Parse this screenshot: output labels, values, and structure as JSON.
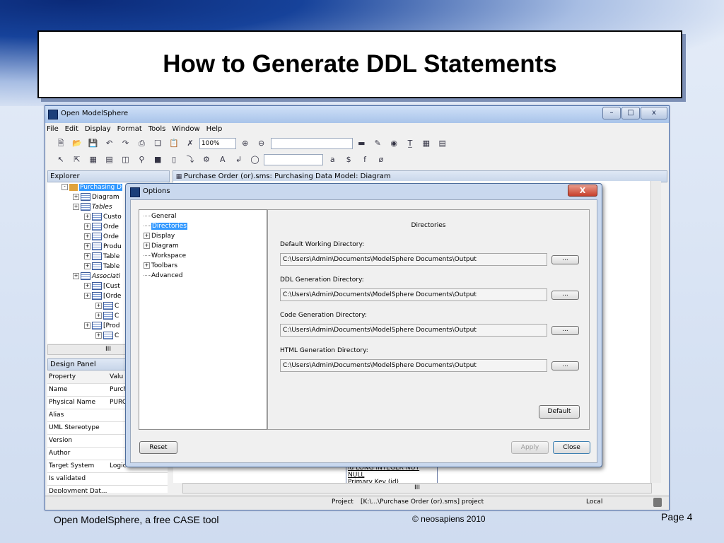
{
  "slide": {
    "title": "How to Generate DDL Statements",
    "footer_left": "Open ModelSphere, a free CASE tool",
    "footer_center": "© neosapiens 2010",
    "footer_right": "Page 4"
  },
  "app": {
    "window_title": "Open ModelSphere",
    "menu": [
      "File",
      "Edit",
      "Display",
      "Format",
      "Tools",
      "Window",
      "Help"
    ],
    "zoom": "100%",
    "format_glyphs": [
      "a",
      "$",
      "f",
      "ø"
    ]
  },
  "explorer": {
    "header": "Explorer",
    "root": "Purchasing D",
    "items": [
      {
        "label": "Diagram",
        "indent": 1
      },
      {
        "label": "Tables",
        "indent": 1
      },
      {
        "label": "Custo",
        "indent": 2
      },
      {
        "label": "Orde",
        "indent": 2
      },
      {
        "label": "Orde",
        "indent": 2
      },
      {
        "label": "Produ",
        "indent": 2
      },
      {
        "label": "Table",
        "indent": 2
      },
      {
        "label": "Table",
        "indent": 2
      },
      {
        "label": "Associati",
        "indent": 1
      },
      {
        "label": "[Cust",
        "indent": 2
      },
      {
        "label": "[Orde",
        "indent": 2
      },
      {
        "label": "C",
        "indent": 3
      },
      {
        "label": "C",
        "indent": 3
      },
      {
        "label": "[Prod",
        "indent": 2
      },
      {
        "label": "C",
        "indent": 3
      }
    ],
    "hscroll_glyph": "III"
  },
  "design_panel": {
    "header": "Design Panel",
    "col_property": "Property",
    "col_value": "Valu",
    "rows": [
      {
        "property": "Name",
        "value": "Purch"
      },
      {
        "property": "Physical Name",
        "value": "PURC"
      },
      {
        "property": "Alias",
        "value": ""
      },
      {
        "property": "UML Stereotype",
        "value": ""
      },
      {
        "property": "Version",
        "value": ""
      },
      {
        "property": "Author",
        "value": ""
      },
      {
        "property": "Target System",
        "value": "Logic"
      },
      {
        "property": "Is validated",
        "value": ""
      },
      {
        "property": "Deployment Dat...",
        "value": ""
      }
    ]
  },
  "diagram_tab": {
    "title": "Purchase Order (or).sms: Purchasing Data Model: Diagram",
    "column_text": "id LONG INTEGER NOT NULL",
    "pk_text": "Primary Key (id)",
    "hscroll_glyph": "III"
  },
  "dialog": {
    "title": "Options",
    "close_glyph": "X",
    "nav": [
      {
        "label": "General",
        "expandable": false,
        "selected": false
      },
      {
        "label": "Directories",
        "expandable": false,
        "selected": true
      },
      {
        "label": "Display",
        "expandable": true,
        "selected": false
      },
      {
        "label": "Diagram",
        "expandable": true,
        "selected": false
      },
      {
        "label": "Workspace",
        "expandable": false,
        "selected": false
      },
      {
        "label": "Toolbars",
        "expandable": true,
        "selected": false
      },
      {
        "label": "Advanced",
        "expandable": false,
        "selected": false
      }
    ],
    "section_title": "Directories",
    "fields": [
      {
        "label": "Default Working Directory:",
        "value": "C:\\Users\\Admin\\Documents\\ModelSphere Documents\\Output",
        "browse": "..."
      },
      {
        "label": "DDL Generation Directory:",
        "value": "C:\\Users\\Admin\\Documents\\ModelSphere Documents\\Output",
        "browse": "..."
      },
      {
        "label": "Code Generation Directory:",
        "value": "C:\\Users\\Admin\\Documents\\ModelSphere Documents\\Output",
        "browse": "..."
      },
      {
        "label": "HTML Generation Directory:",
        "value": "C:\\Users\\Admin\\Documents\\ModelSphere Documents\\Output",
        "browse": "..."
      }
    ],
    "default_button": "Default",
    "reset_button": "Reset",
    "apply_button": "Apply",
    "close_button": "Close"
  },
  "status": {
    "project_label": "Project",
    "path": "[K:\\...\\Purchase Order (or).sms]  project",
    "location": "Local"
  }
}
